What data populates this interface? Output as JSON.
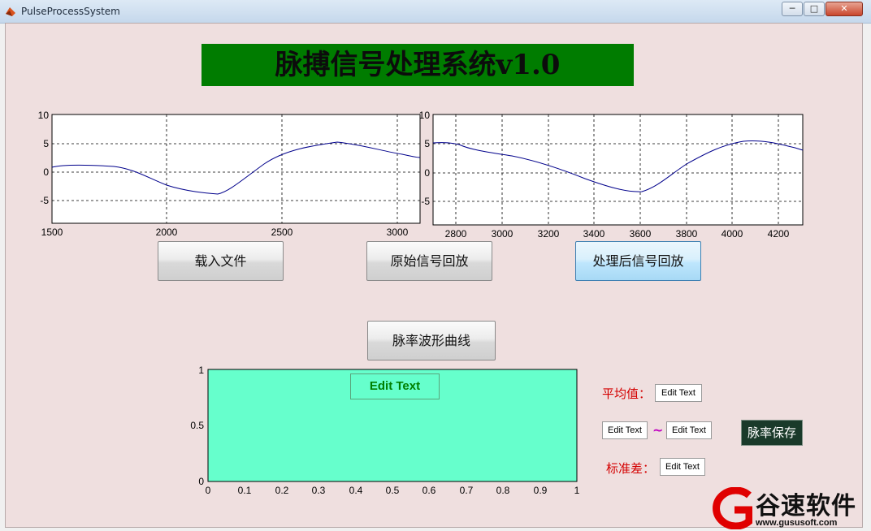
{
  "window": {
    "title": "PulseProcessSystem",
    "minimize": "─",
    "maximize": "□",
    "close": "✕"
  },
  "banner": {
    "title": "脉搏信号处理系统v1.0",
    "bg_color": "#007c00"
  },
  "plots": {
    "left": {
      "yticks": [
        "10",
        "5",
        "0",
        "-5"
      ],
      "xticks": [
        "1500",
        "2000",
        "2500",
        "3000"
      ]
    },
    "right": {
      "yticks": [
        "10",
        "5",
        "0",
        "-5"
      ],
      "xticks": [
        "2800",
        "3000",
        "3200",
        "3400",
        "3600",
        "3800",
        "4000",
        "4200"
      ]
    },
    "bottom": {
      "yticks": [
        "1",
        "0.5",
        "0"
      ],
      "xticks": [
        "0",
        "0.1",
        "0.2",
        "0.3",
        "0.4",
        "0.5",
        "0.6",
        "0.7",
        "0.8",
        "0.9",
        "1"
      ],
      "fill_color": "#66ffcc",
      "edit_text": "Edit Text"
    }
  },
  "buttons": {
    "load_file": "载入文件",
    "raw_playback": "原始信号回放",
    "processed_playback": "处理后信号回放",
    "pulse_waveform": "脉率波形曲线",
    "save_rate": "脉率保存"
  },
  "stats": {
    "mean_label": "平均值：",
    "mean_value": "Edit Text",
    "range_min": "Edit Text",
    "range_sep": "~",
    "range_max": "Edit Text",
    "std_label": "标准差：",
    "std_value": "Edit Text"
  },
  "watermark": {
    "brand": "谷速软件",
    "url": "www.gususoft.com"
  },
  "icons": {
    "app": "matlab-icon"
  }
}
